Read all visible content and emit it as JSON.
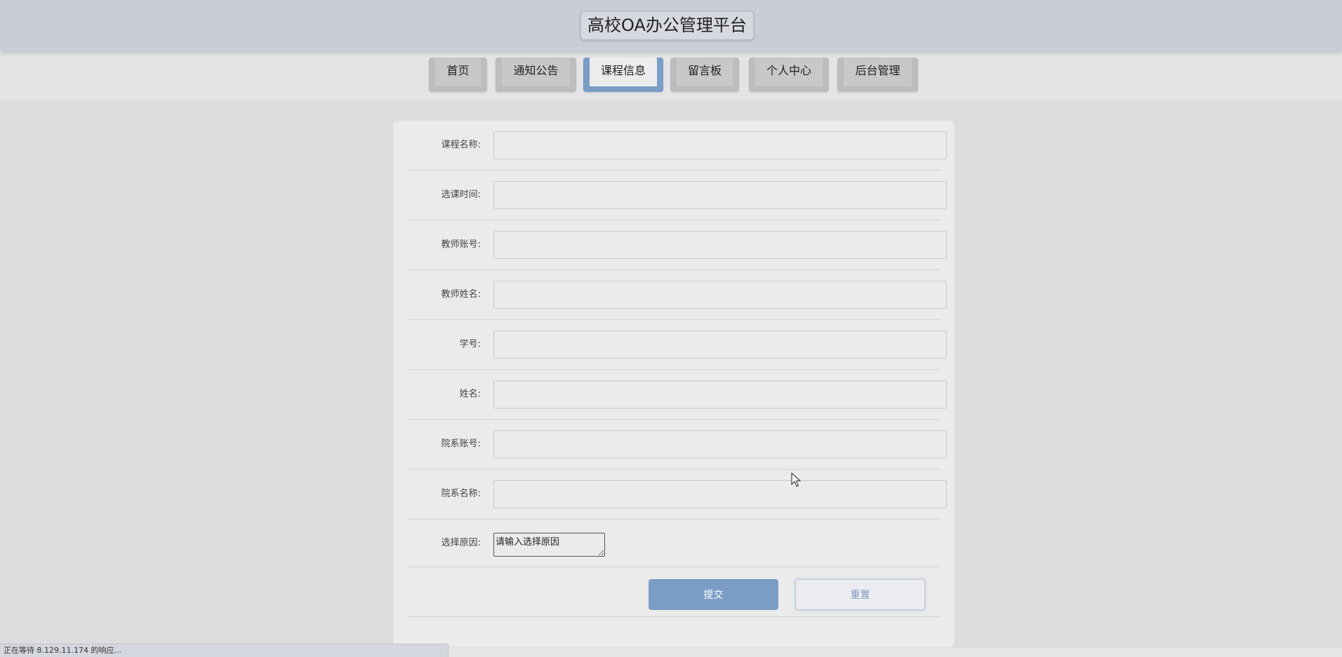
{
  "header": {
    "title": "高校OA办公管理平台"
  },
  "nav": {
    "items": [
      {
        "label": "首页"
      },
      {
        "label": "通知公告"
      },
      {
        "label": "课程信息"
      },
      {
        "label": "留言板"
      },
      {
        "label": "个人中心"
      },
      {
        "label": "后台管理"
      }
    ],
    "active": "课程信息"
  },
  "form": {
    "fields": [
      {
        "label": "课程名称:",
        "value": ""
      },
      {
        "label": "选课时间:",
        "value": ""
      },
      {
        "label": "教师账号:",
        "value": ""
      },
      {
        "label": "教师姓名:",
        "value": ""
      },
      {
        "label": "学号:",
        "value": ""
      },
      {
        "label": "姓名:",
        "value": ""
      },
      {
        "label": "院系账号:",
        "value": ""
      },
      {
        "label": "院系名称:",
        "value": ""
      }
    ],
    "reason": {
      "label": "选择原因:",
      "placeholder": "请输入选择原因"
    },
    "submit_label": "提交",
    "reset_label": "重置"
  },
  "status_bar": {
    "text": "正在等待 8.129.11.174 的响应..."
  },
  "colors": {
    "accent": "#7b9cc4",
    "header_bg": "#c9cdd6",
    "page_bg": "#dcdcdd",
    "card_bg": "#ebebec"
  }
}
